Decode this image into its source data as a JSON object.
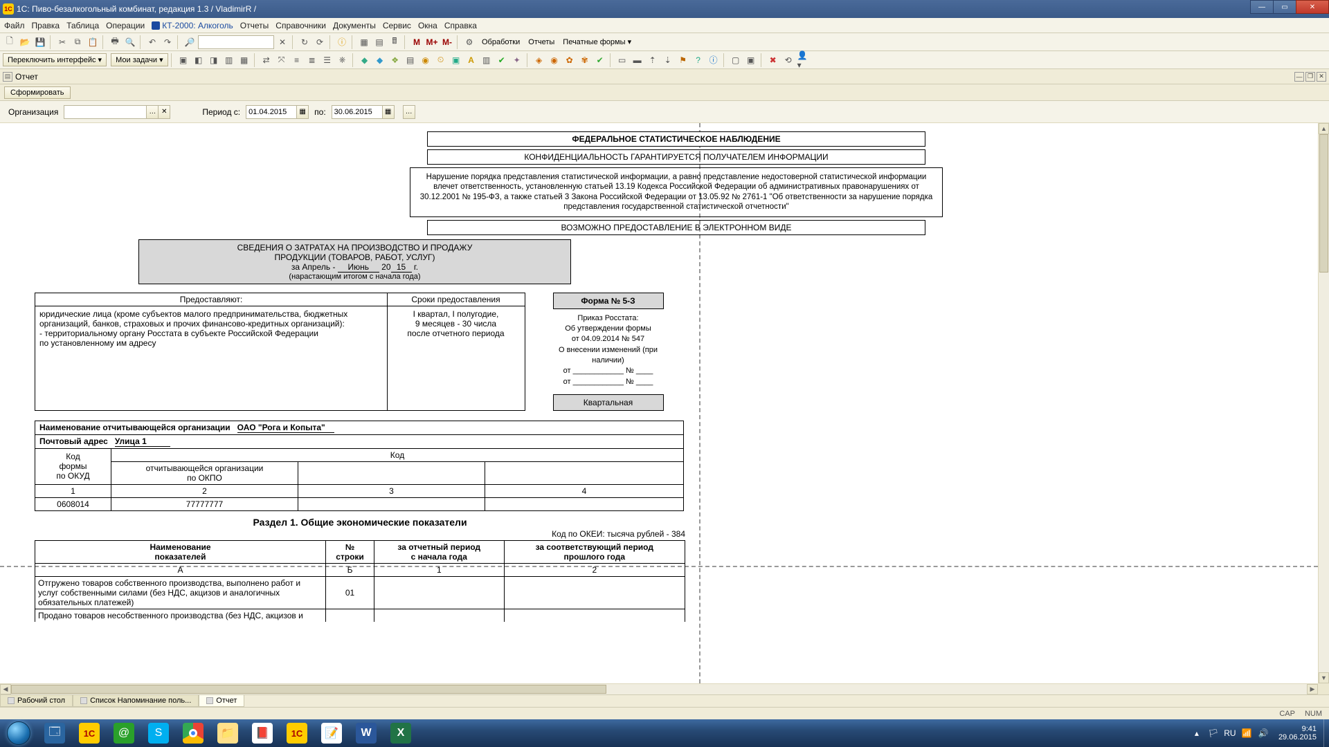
{
  "window": {
    "title": "1С: Пиво-безалкогольный комбинат, редакция 1.3 / VladimirR /"
  },
  "menu": [
    "Файл",
    "Правка",
    "Таблица",
    "Операции",
    "КТ-2000: Алкоголь",
    "Отчеты",
    "Справочники",
    "Документы",
    "Сервис",
    "Окна",
    "Справка"
  ],
  "toolbar1": {
    "btns": [
      "Переключить интерфейс ▾",
      "Мои задачи ▾"
    ],
    "extras": [
      "M",
      "M+",
      "M-"
    ],
    "labels": [
      "Обработки",
      "Отчеты",
      "Печатные формы ▾"
    ]
  },
  "doctab": {
    "title": "Отчет"
  },
  "formbar": {
    "build": "Сформировать"
  },
  "filter": {
    "org_label": "Организация",
    "org_value": "",
    "period_from_label": "Период с:",
    "period_from": "01.04.2015",
    "period_to_label": "по:",
    "period_to": "30.06.2015"
  },
  "report": {
    "header1": "ФЕДЕРАЛЬНОЕ СТАТИСТИЧЕСКОЕ НАБЛЮДЕНИЕ",
    "header2": "КОНФИДЕНЦИАЛЬНОСТЬ ГАРАНТИРУЕТСЯ ПОЛУЧАТЕЛЕМ ИНФОРМАЦИИ",
    "warning": "Нарушение порядка представления статистической информации, а равно представление недостоверной статистической информации влечет ответственность, установленную статьей 13.19 Кодекса Российской Федерации об административных правонарушениях от 30.12.2001 № 195-ФЗ, а также статьей 3 Закона Российской Федерации от 13.05.92 № 2761-1 \"Об ответственности за нарушение порядка представления государственной статистической отчетности\"",
    "header4": "ВОЗМОЖНО ПРЕДОСТАВЛЕНИЕ В ЭЛЕКТРОННОМ ВИДЕ",
    "svedeniya_l1": "СВЕДЕНИЯ О ЗАТРАТАХ НА ПРОИЗВОДСТВО И ПРОДАЖУ",
    "svedeniya_l2": "ПРОДУКЦИИ (ТОВАРОВ, РАБОТ, УСЛУГ)",
    "period_prefix": "за Апрель  -",
    "period_month": "Июнь",
    "period_year_pre": "20",
    "period_year": "15",
    "period_suffix": "г.",
    "narast": "(нарастающим итогом с начала года)",
    "providers_h": "Предоставляют:",
    "providers_txt": "юридические лица (кроме субъектов малого предпринимательства, бюджетных организаций, банков, страховых и прочих финансово-кредитных организаций):\n   - территориальному органу Росстата в субъекте Российской Федерации\n     по установленному им адресу",
    "deadline_h": "Сроки предоставления",
    "deadline_txt": "I квартал, I полугодие,\n9 месяцев - 30 числа\nпосле отчетного периода",
    "form_name": "Форма № 5-З",
    "prikaz": "Приказ Росстата:\nОб утверждении формы\nот 04.09.2014 № 547\nО внесении изменений (при наличии)\nот ____________ № ____\nот ____________ № ____",
    "kvart": "Квартальная",
    "org_name_lab": "Наименование отчитывающейся организации",
    "org_name": "ОАО \"Рога и Копыта\"",
    "addr_lab": "Почтовый адрес",
    "addr": "Улица 1",
    "kod_formy": "Код\nформы\nпо ОКУД",
    "kod_h": "Код",
    "kod_org": "отчитывающейся организации\nпо ОКПО",
    "row_nums": [
      "1",
      "2",
      "3",
      "4"
    ],
    "okud": "0608014",
    "okpo": "77777777",
    "section": "Раздел 1. Общие экономические показатели",
    "okei": "Код по ОКЕИ: тысяча рублей - 384",
    "data_headers": [
      "Наименование\nпоказателей",
      "№\nстроки",
      "за отчетный период\nс начала года",
      "за соответствующий период\nпрошлого года"
    ],
    "data_sub": [
      "А",
      "Б",
      "1",
      "2"
    ],
    "row01_name": "Отгружено товаров собственного производства, выполнено работ и услуг собственными силами (без НДС, акцизов и аналогичных обязательных платежей)",
    "row01_num": "01",
    "row02_name": "Продано товаров несобственного производства (без НДС, акцизов и"
  },
  "wintabs": [
    {
      "label": "Рабочий стол",
      "active": false
    },
    {
      "label": "Список Напоминание поль...",
      "active": false
    },
    {
      "label": "Отчет",
      "active": true
    }
  ],
  "status": {
    "cap": "CAP",
    "num": "NUM"
  },
  "tray": {
    "time": "9:41",
    "date": "29.06.2015",
    "lang": "RU"
  }
}
